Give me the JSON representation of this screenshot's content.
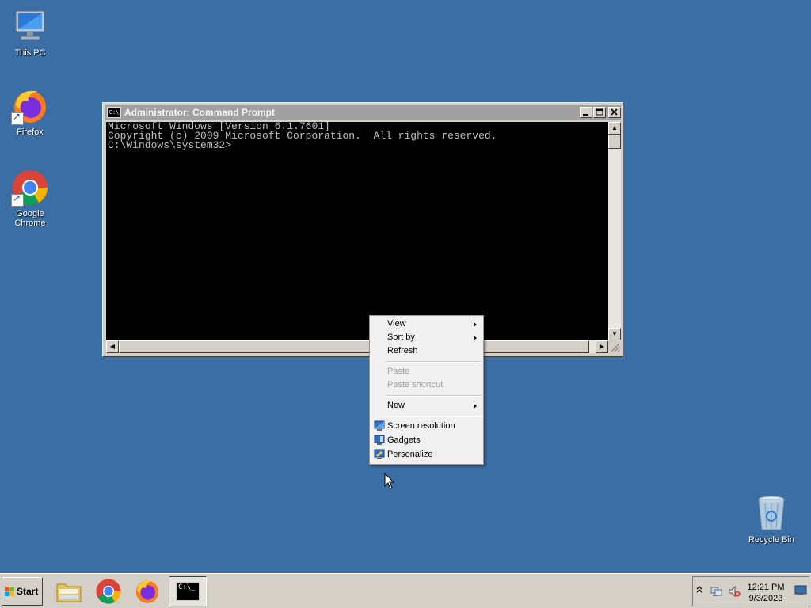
{
  "desktop": {
    "icons": [
      {
        "label": "This PC"
      },
      {
        "label": "Firefox"
      },
      {
        "label": "Google Chrome"
      },
      {
        "label": "Recycle Bin"
      }
    ]
  },
  "window": {
    "icon_text": "C:\\",
    "title": "Administrator: Command Prompt",
    "console_lines": [
      "Microsoft Windows [Version 6.1.7601]",
      "Copyright (c) 2009 Microsoft Corporation.  All rights reserved.",
      "",
      "C:\\Windows\\system32>"
    ]
  },
  "context_menu": {
    "view": "View",
    "sort_by": "Sort by",
    "refresh": "Refresh",
    "paste": "Paste",
    "paste_shortcut": "Paste shortcut",
    "new": "New",
    "screen_resolution": "Screen resolution",
    "gadgets": "Gadgets",
    "personalize": "Personalize"
  },
  "taskbar": {
    "start_label": "Start",
    "cmd_icon_text": "C:\\_",
    "clock_time": "12:21 PM",
    "clock_date": "9/3/2023"
  },
  "colors": {
    "desktop": "#3a6ea5",
    "titlebar_inactive": "#a0a0a0",
    "console_bg": "#000000",
    "console_fg": "#c0c0c0"
  }
}
